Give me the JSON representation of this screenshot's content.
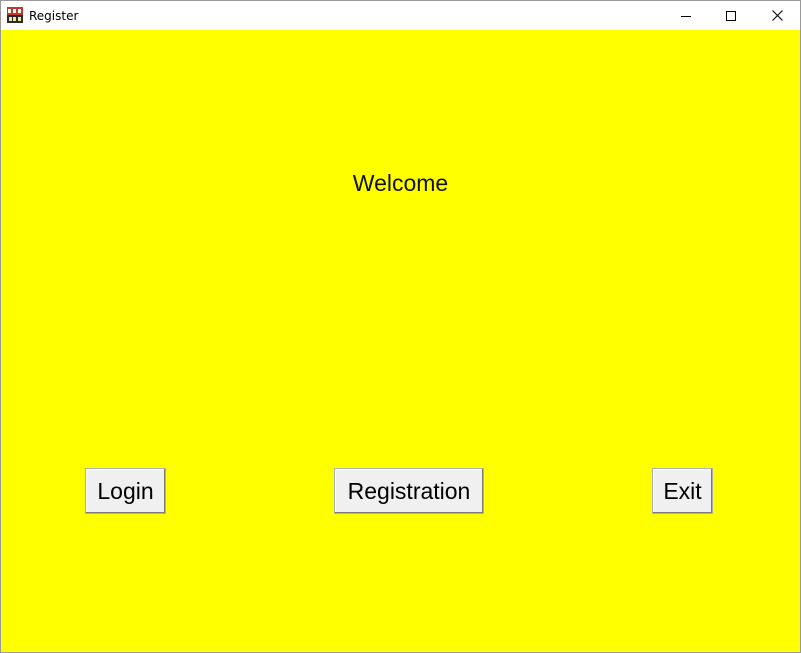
{
  "window": {
    "title": "Register",
    "icon": "java-app-icon",
    "controls": {
      "minimize": "minimize-icon",
      "maximize": "maximize-icon",
      "close": "close-icon"
    }
  },
  "main": {
    "background": "#ffff00",
    "welcome_text": "Welcome",
    "buttons": {
      "login": "Login",
      "registration": "Registration",
      "exit": "Exit"
    }
  }
}
